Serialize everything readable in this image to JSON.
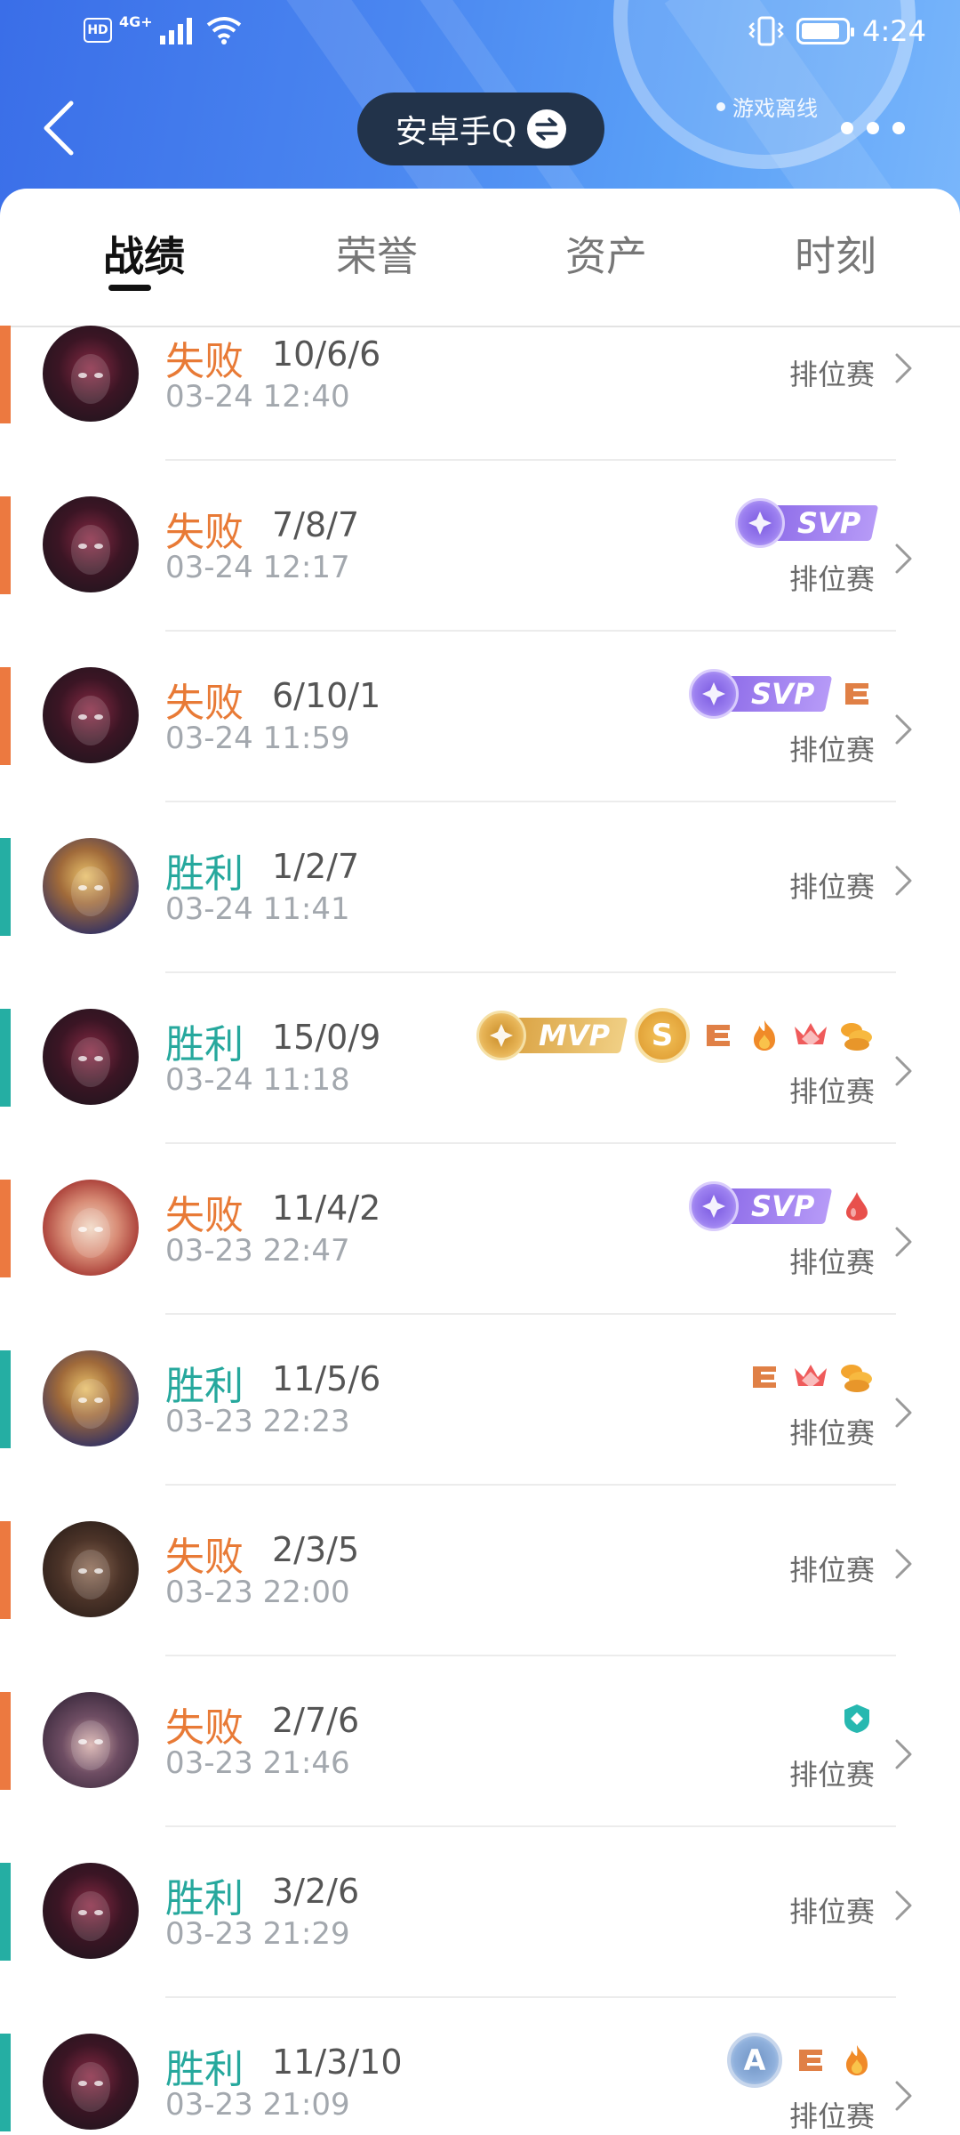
{
  "status_bar": {
    "hd": "HD",
    "network": "4G+",
    "time": "4:24",
    "icons": [
      "signal-icon",
      "wifi-icon",
      "vibrate-icon",
      "battery-icon"
    ]
  },
  "header": {
    "account_name": "安卓手Q",
    "offline_label": "游戏离线",
    "icons": [
      "back-icon",
      "swap-icon",
      "more-icon"
    ]
  },
  "tabs": [
    {
      "label": "战绩",
      "active": true
    },
    {
      "label": "荣誉",
      "active": false
    },
    {
      "label": "资产",
      "active": false
    },
    {
      "label": "时刻",
      "active": false
    }
  ],
  "colors": {
    "loss": "#e87a36",
    "win": "#26a89d",
    "header": "#4a86f0"
  },
  "matches": [
    {
      "result": "失败",
      "kda": "10/6/6",
      "time": "03-24 12:40",
      "mode": "排位赛",
      "hero": "dark-hero",
      "badges": []
    },
    {
      "result": "失败",
      "kda": "7/8/7",
      "time": "03-24 12:17",
      "mode": "排位赛",
      "hero": "dark-hero",
      "badges": [
        "SVP"
      ]
    },
    {
      "result": "失败",
      "kda": "6/10/1",
      "time": "03-24 11:59",
      "mode": "排位赛",
      "hero": "dark-hero",
      "badges": [
        "SVP",
        "triple-kill-icon"
      ]
    },
    {
      "result": "胜利",
      "kda": "1/2/7",
      "time": "03-24 11:41",
      "mode": "排位赛",
      "hero": "blond-hero",
      "badges": []
    },
    {
      "result": "胜利",
      "kda": "15/0/9",
      "time": "03-24 11:18",
      "mode": "排位赛",
      "hero": "dark-hero",
      "badges": [
        "MVP",
        "s-coin-icon",
        "triple-kill-icon",
        "fire-icon",
        "crown-icon",
        "gold-icon"
      ]
    },
    {
      "result": "失败",
      "kda": "11/4/2",
      "time": "03-23 22:47",
      "mode": "排位赛",
      "hero": "red-hero",
      "badges": [
        "SVP",
        "blood-icon"
      ]
    },
    {
      "result": "胜利",
      "kda": "11/5/6",
      "time": "03-23 22:23",
      "mode": "排位赛",
      "hero": "blond-hero",
      "badges": [
        "triple-kill-icon",
        "crown-icon",
        "gold-icon"
      ]
    },
    {
      "result": "失败",
      "kda": "2/3/5",
      "time": "03-23 22:00",
      "mode": "排位赛",
      "hero": "bearded-hero",
      "badges": []
    },
    {
      "result": "失败",
      "kda": "2/7/6",
      "time": "03-23 21:46",
      "mode": "排位赛",
      "hero": "hooded-hero",
      "badges": [
        "shield-icon"
      ]
    },
    {
      "result": "胜利",
      "kda": "3/2/6",
      "time": "03-23 21:29",
      "mode": "排位赛",
      "hero": "dark-hero",
      "badges": []
    },
    {
      "result": "胜利",
      "kda": "11/3/10",
      "time": "03-23 21:09",
      "mode": "排位赛",
      "hero": "dark-hero",
      "badges": [
        "a-rank-icon",
        "triple-kill-icon",
        "fire-icon"
      ]
    }
  ]
}
